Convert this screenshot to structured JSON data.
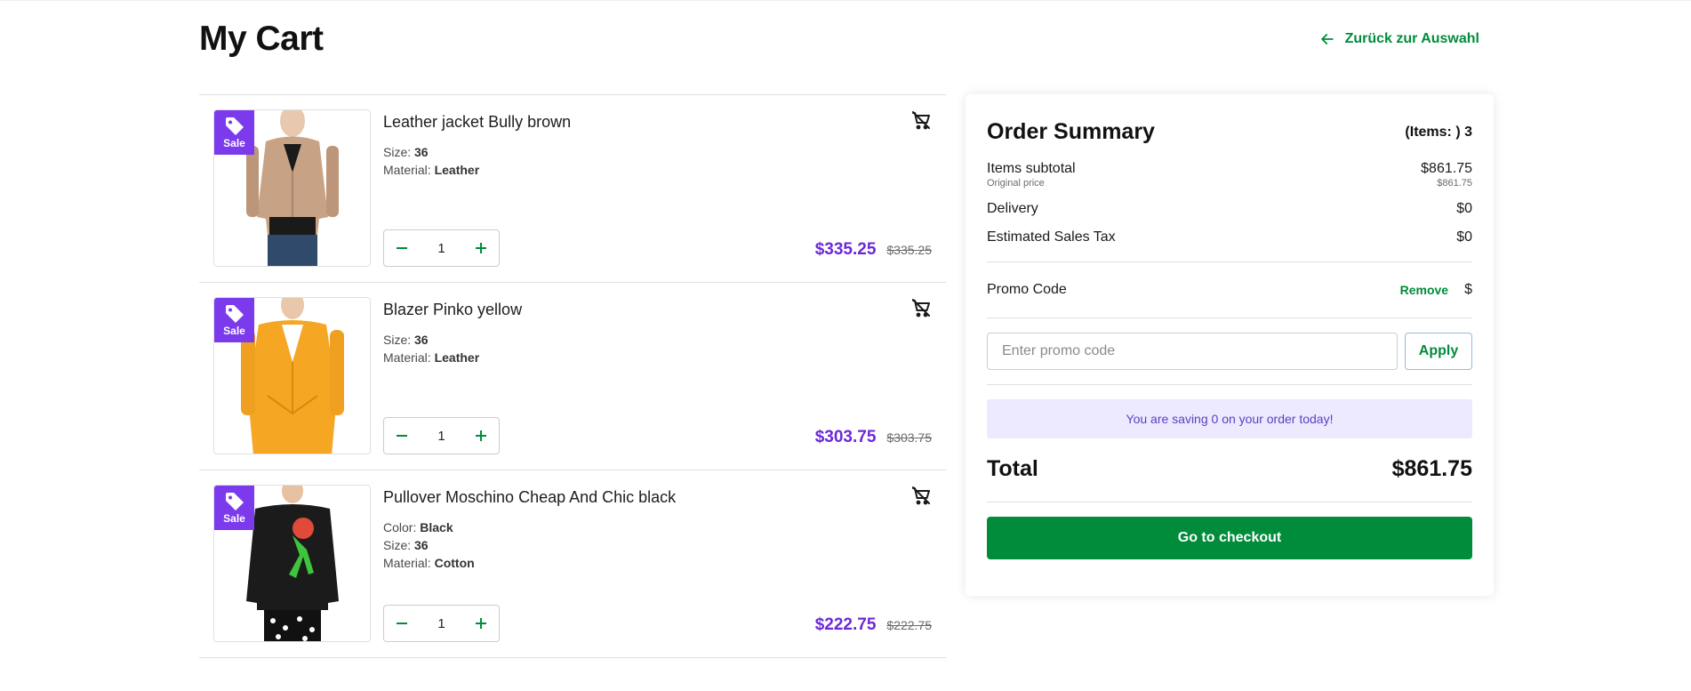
{
  "page": {
    "title": "My Cart"
  },
  "nav": {
    "back_label": "Zurück zur Auswahl"
  },
  "cart": {
    "items": [
      {
        "badge": "Sale",
        "name": "Leather jacket Bully brown",
        "attributes": [
          {
            "label": "Size:",
            "value": "36"
          },
          {
            "label": "Material:",
            "value": "Leather"
          }
        ],
        "quantity": "1",
        "price": "$335.25",
        "original_price": "$335.25",
        "product_color": "#c8a285"
      },
      {
        "badge": "Sale",
        "name": "Blazer Pinko yellow",
        "attributes": [
          {
            "label": "Size:",
            "value": "36"
          },
          {
            "label": "Material:",
            "value": "Leather"
          }
        ],
        "quantity": "1",
        "price": "$303.75",
        "original_price": "$303.75",
        "product_color": "#f5a623"
      },
      {
        "badge": "Sale",
        "name": "Pullover Moschino Cheap And Chic black",
        "attributes": [
          {
            "label": "Color:",
            "value": "Black"
          },
          {
            "label": "Size:",
            "value": "36"
          },
          {
            "label": "Material:",
            "value": "Cotton"
          }
        ],
        "quantity": "1",
        "price": "$222.75",
        "original_price": "$222.75",
        "product_color": "#1b1b1b"
      }
    ]
  },
  "summary": {
    "title": "Order Summary",
    "items_label": "(Items: ) 3",
    "subtotal_label": "Items subtotal",
    "subtotal_value": "$861.75",
    "original_label": "Original price",
    "original_value": "$861.75",
    "delivery_label": "Delivery",
    "delivery_value": "$0",
    "tax_label": "Estimated Sales Tax",
    "tax_value": "$0",
    "promo_label": "Promo Code",
    "promo_remove": "Remove",
    "promo_value": "$",
    "promo_placeholder": "Enter promo code",
    "apply_label": "Apply",
    "saving_text": "You are saving 0 on your order today!",
    "total_label": "Total",
    "total_value": "$861.75",
    "checkout_label": "Go to checkout"
  },
  "colors": {
    "accent_green": "#008c3a",
    "sale_purple": "#7c3aed",
    "price_purple": "#6d28d9"
  }
}
